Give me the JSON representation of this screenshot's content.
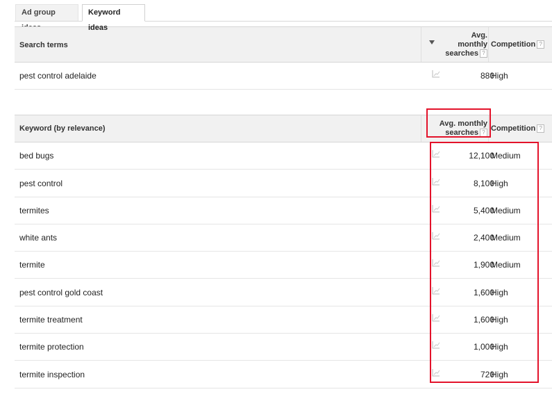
{
  "tabs": [
    {
      "label": "Ad group ideas",
      "active": false
    },
    {
      "label": "Keyword ideas",
      "active": true
    }
  ],
  "search_table": {
    "headers": {
      "keyword": "Search terms",
      "avg_line1": "Avg.",
      "avg_line2": "monthly",
      "avg_line3": "searches",
      "competition": "Competition",
      "help": "?"
    },
    "rows": [
      {
        "keyword": "pest control adelaide",
        "avg": "880",
        "competition": "High"
      }
    ]
  },
  "keyword_table": {
    "headers": {
      "keyword": "Keyword (by relevance)",
      "avg_line1": "Avg. monthly",
      "avg_line2": "searches",
      "competition": "Competition",
      "help": "?"
    },
    "rows": [
      {
        "keyword": "bed bugs",
        "avg": "12,100",
        "competition": "Medium"
      },
      {
        "keyword": "pest control",
        "avg": "8,100",
        "competition": "High"
      },
      {
        "keyword": "termites",
        "avg": "5,400",
        "competition": "Medium"
      },
      {
        "keyword": "white ants",
        "avg": "2,400",
        "competition": "Medium"
      },
      {
        "keyword": "termite",
        "avg": "1,900",
        "competition": "Medium"
      },
      {
        "keyword": "pest control gold coast",
        "avg": "1,600",
        "competition": "High"
      },
      {
        "keyword": "termite treatment",
        "avg": "1,600",
        "competition": "High"
      },
      {
        "keyword": "termite protection",
        "avg": "1,000",
        "competition": "High"
      },
      {
        "keyword": "termite inspection",
        "avg": "720",
        "competition": "High"
      }
    ]
  },
  "colors": {
    "highlight": "#e3122a",
    "header_bg": "#f1f1f1"
  },
  "icons": {
    "trend": "trend-chart-icon",
    "sort": "sort-down-arrow-icon",
    "help": "help-icon"
  }
}
